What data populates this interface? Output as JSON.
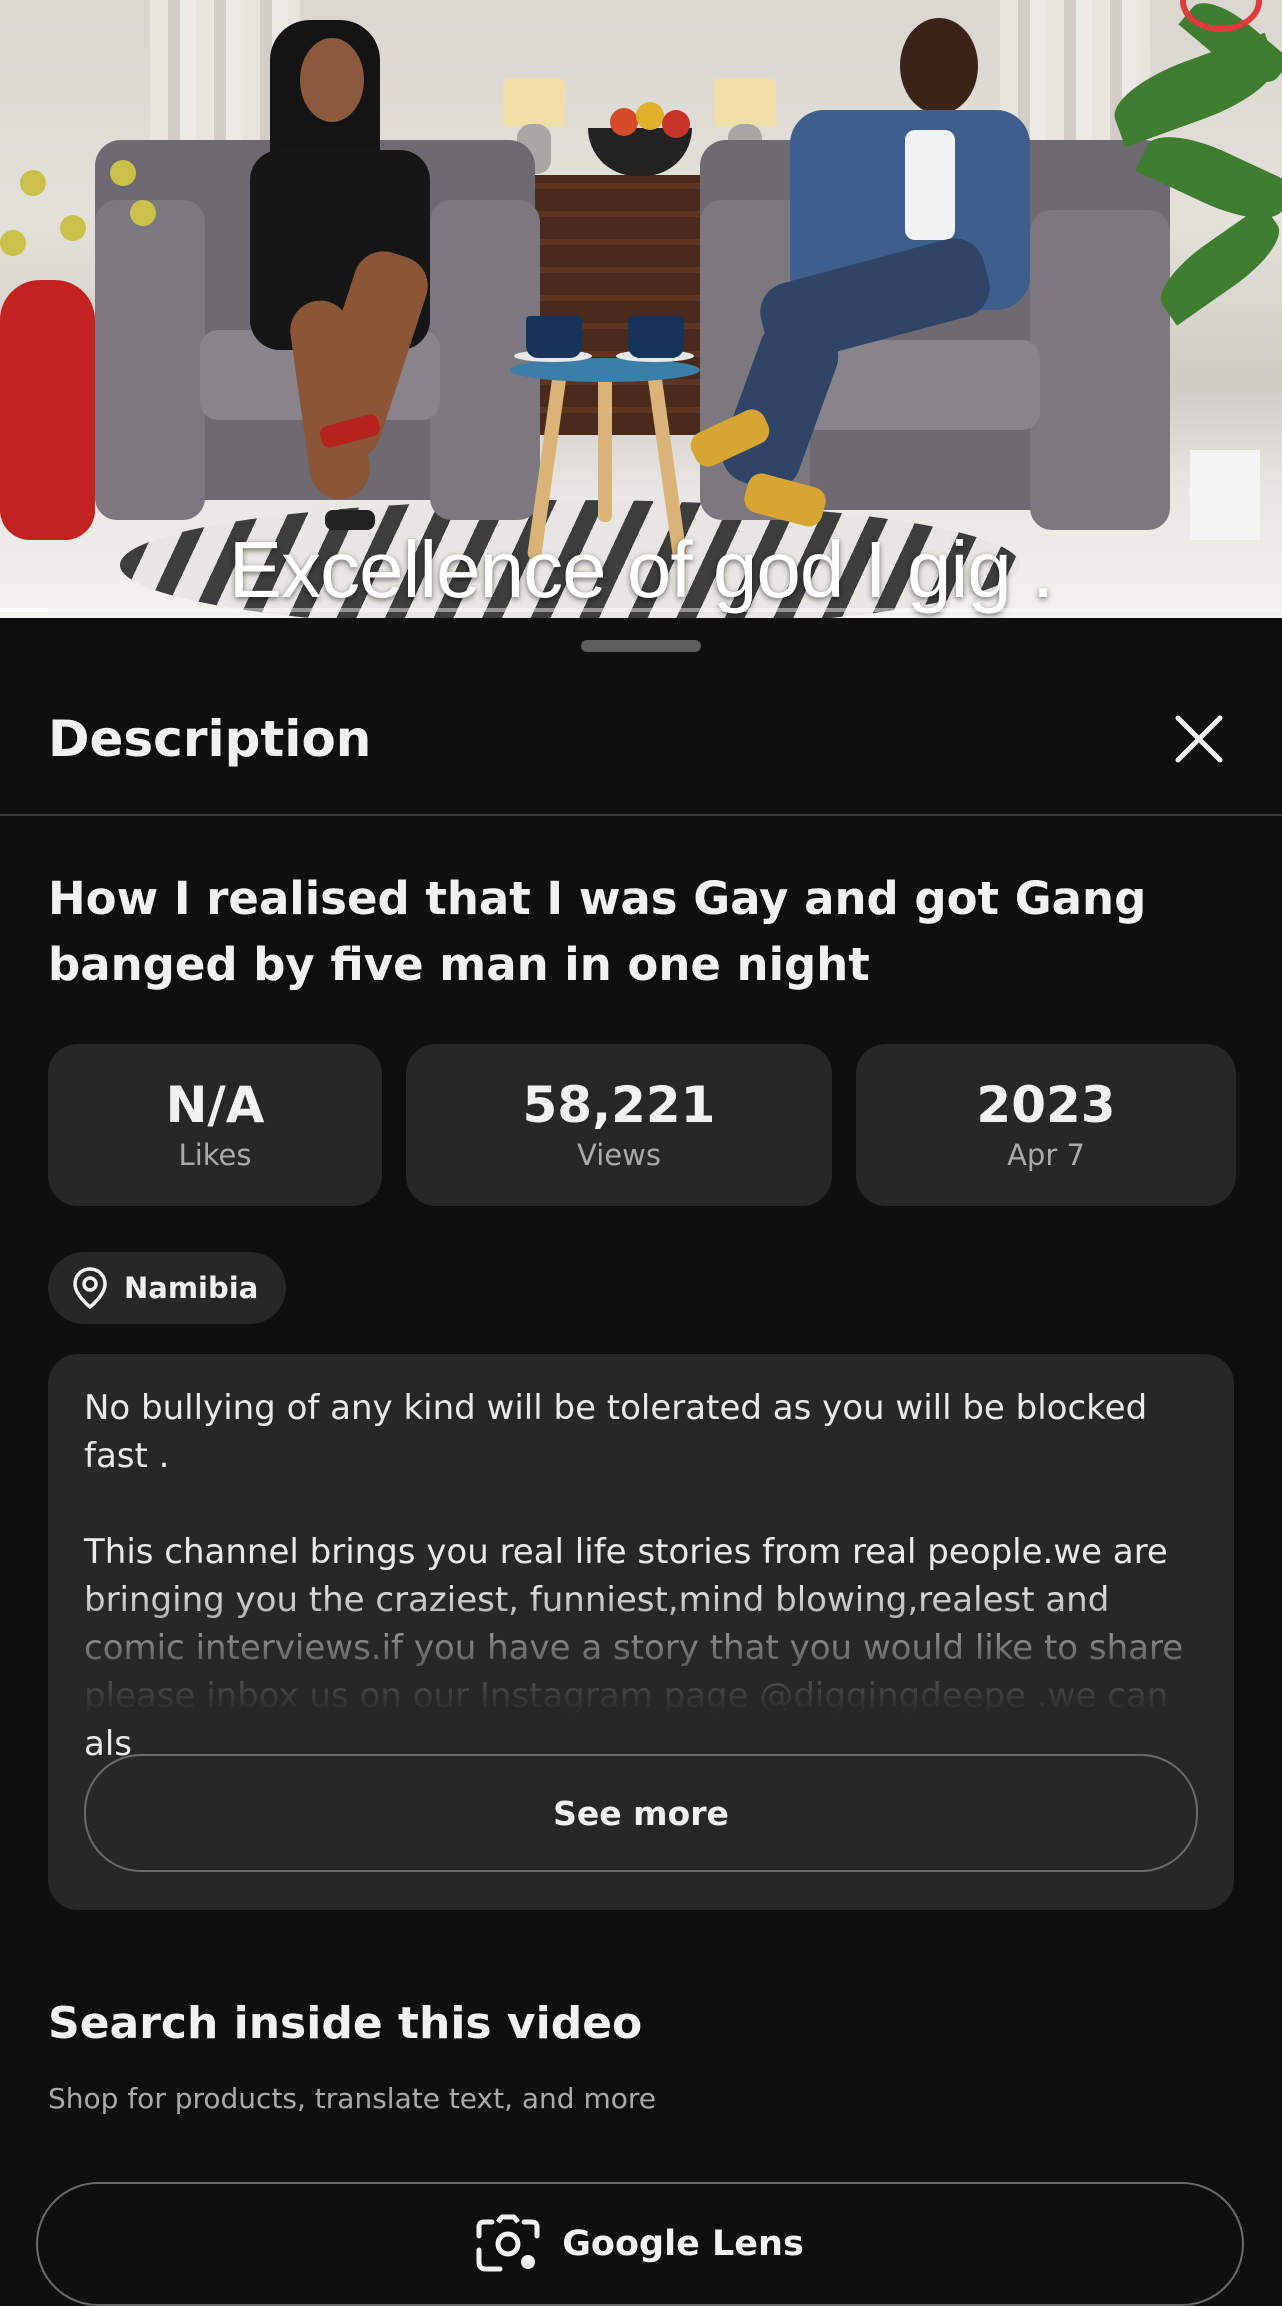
{
  "video": {
    "caption": "Excellence of god I gig ."
  },
  "sheet": {
    "title": "Description",
    "close_icon": "close-icon"
  },
  "video_info": {
    "title": "How I realised that I was Gay and got Gang banged by five man in one night",
    "stats": [
      {
        "value": "N/A",
        "label": "Likes"
      },
      {
        "value": "58,221",
        "label": "Views"
      },
      {
        "value": "2023",
        "label": "Apr 7"
      }
    ],
    "location": {
      "label": "Namibia",
      "icon": "location-pin-icon"
    }
  },
  "description": {
    "text": "No bullying of any kind will be tolerated as you will be blocked fast .\n\nThis channel brings you real life stories from real people.we are bringing you the craziest, funniest,mind blowing,realest and comic interviews.if you have a story that you would like to share please inbox us on our Instagram page @diggingdeepe .we can als",
    "see_more_label": "See more"
  },
  "search_section": {
    "title": "Search inside this video",
    "subtitle": "Shop for products, translate text, and more",
    "lens_button_label": "Google Lens",
    "lens_icon": "google-lens-icon"
  },
  "colors": {
    "background": "#0f0f0f",
    "card": "#272727",
    "text_primary": "#f1f1f1",
    "text_secondary": "#aaaaaa"
  }
}
